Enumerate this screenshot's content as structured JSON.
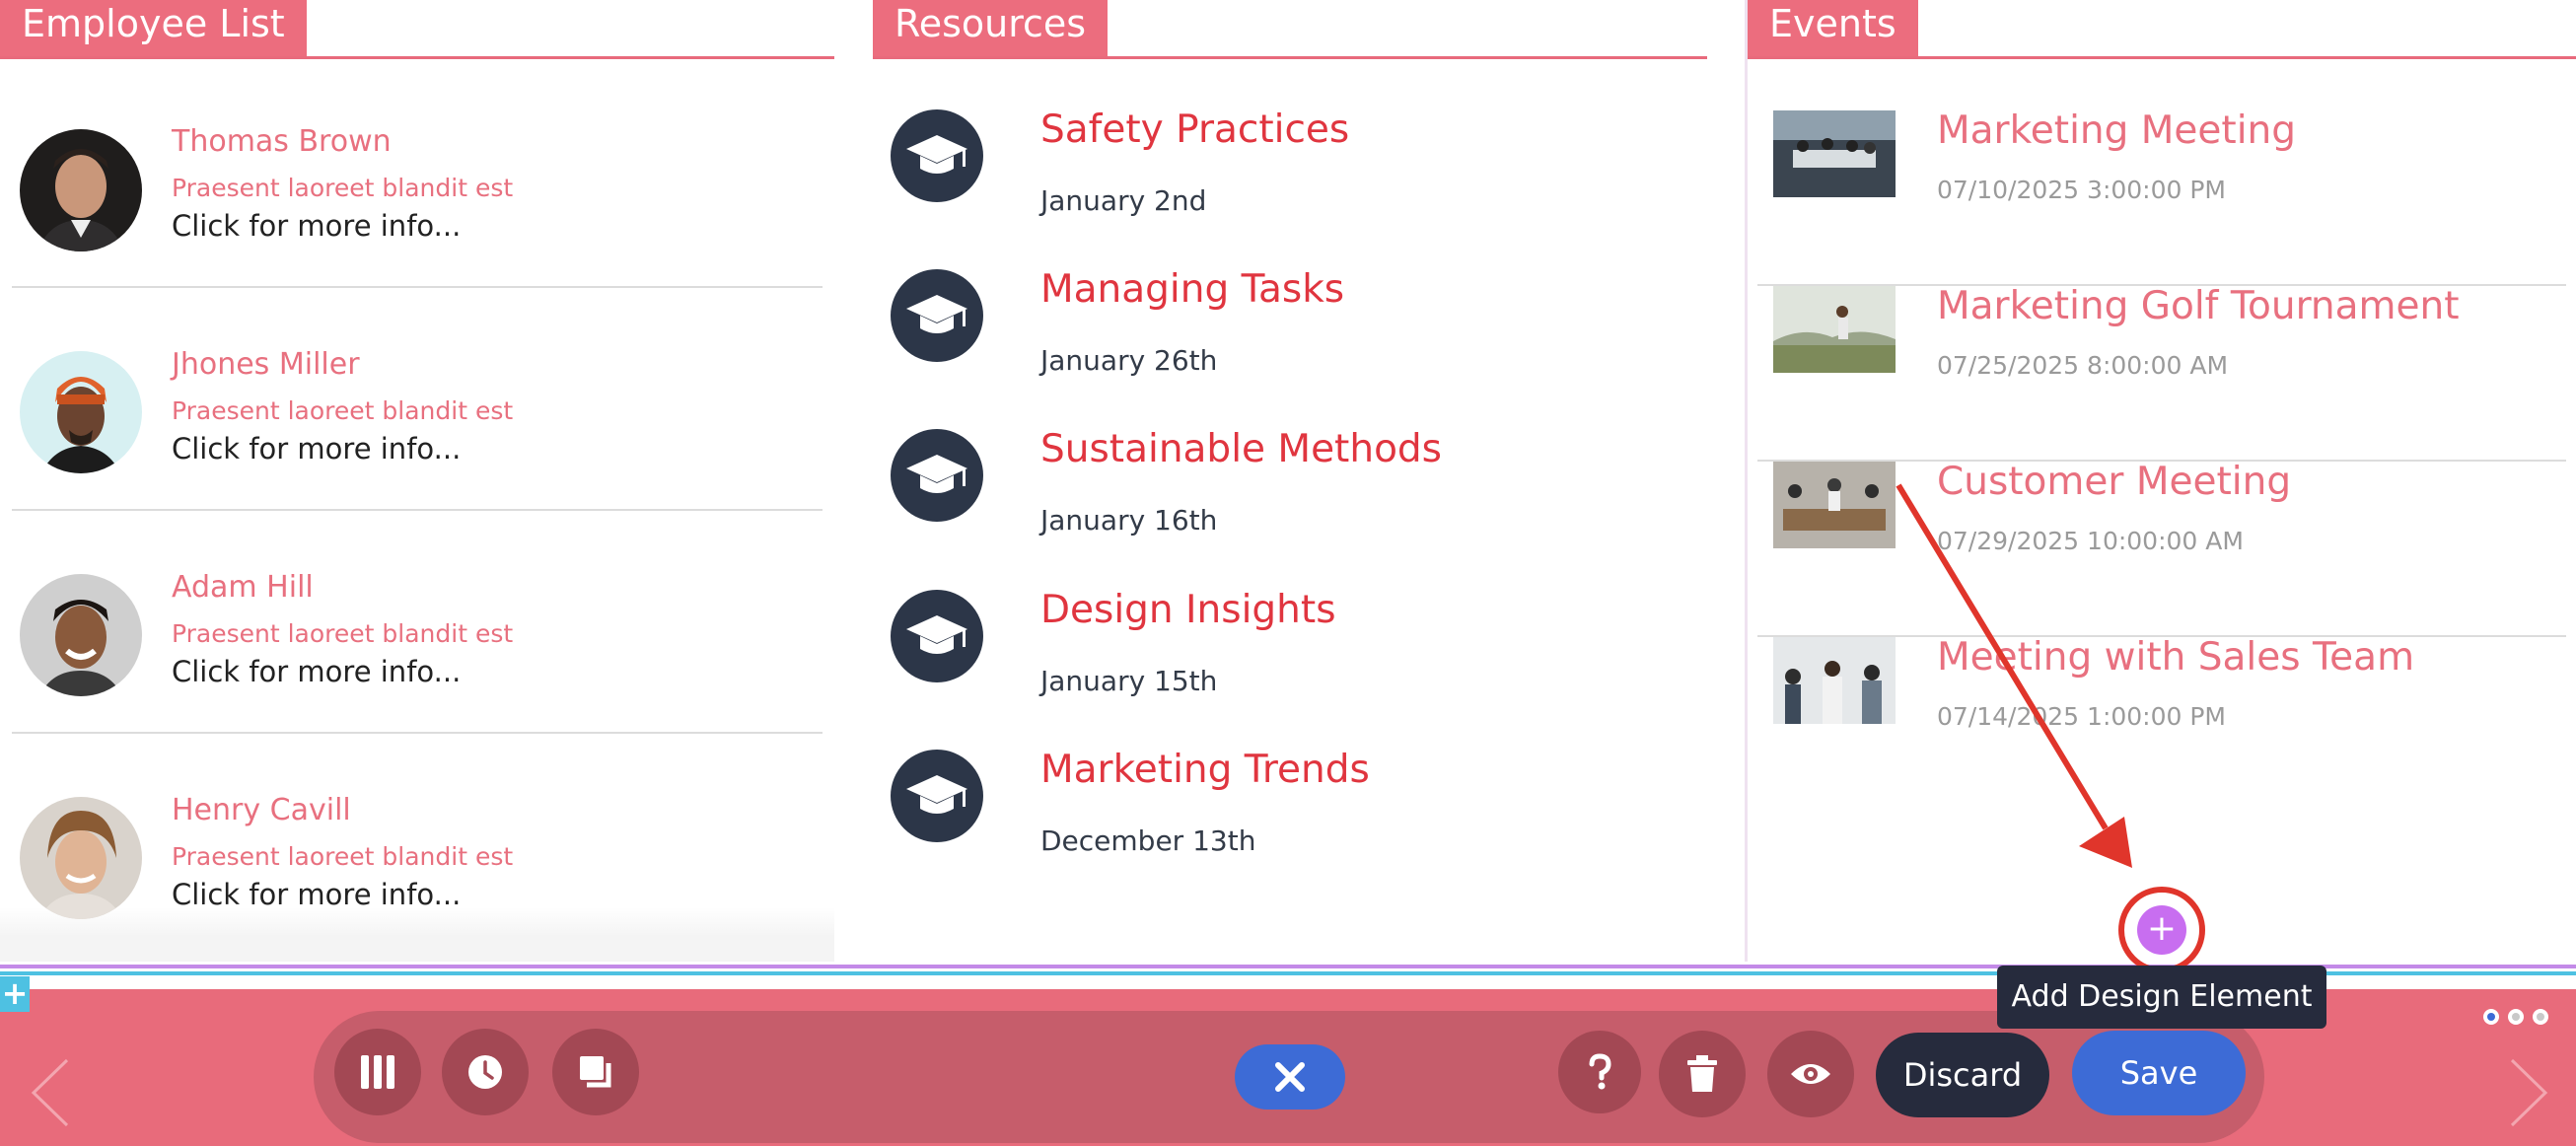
{
  "panels": {
    "employees": {
      "title": "Employee List",
      "items": [
        {
          "name": "Thomas Brown",
          "subtitle": "Praesent laoreet blandit est",
          "info": "Click for more info..."
        },
        {
          "name": "Jhones Miller",
          "subtitle": "Praesent laoreet blandit est",
          "info": "Click for more info..."
        },
        {
          "name": "Adam Hill",
          "subtitle": "Praesent laoreet blandit est",
          "info": "Click for more info..."
        },
        {
          "name": "Henry Cavill",
          "subtitle": "Praesent laoreet blandit est",
          "info": "Click for more info..."
        }
      ]
    },
    "resources": {
      "title": "Resources",
      "items": [
        {
          "title": "Safety Practices",
          "date": "January 2nd"
        },
        {
          "title": "Managing Tasks",
          "date": "January 26th"
        },
        {
          "title": "Sustainable Methods",
          "date": "January 16th"
        },
        {
          "title": "Design Insights",
          "date": "January 15th"
        },
        {
          "title": "Marketing Trends",
          "date": "December 13th"
        }
      ]
    },
    "events": {
      "title": "Events",
      "items": [
        {
          "title": "Marketing Meeting",
          "datetime": "07/10/2025 3:00:00 PM"
        },
        {
          "title": "Marketing Golf Tournament",
          "datetime": "07/25/2025 8:00:00 AM"
        },
        {
          "title": "Customer Meeting",
          "datetime": "07/29/2025 10:00:00 AM"
        },
        {
          "title": "Meeting with Sales Team",
          "datetime": "07/14/2025 1:00:00 PM"
        }
      ]
    }
  },
  "toolbar": {
    "discard_label": "Discard",
    "save_label": "Save",
    "icons": [
      "columns-icon",
      "clock-icon",
      "layers-icon",
      "close-icon",
      "help-icon",
      "trash-icon",
      "eye-icon"
    ]
  },
  "add_element": {
    "tooltip": "Add Design Element",
    "plus": "+"
  },
  "corner_plus": "+",
  "colors": {
    "accent_pink": "#ec6d7e",
    "title_red": "#e0353f",
    "navy": "#262b3d",
    "save_blue": "#3d6bd6",
    "add_purple": "#c86ef0",
    "annotation_red": "#e0352b"
  }
}
